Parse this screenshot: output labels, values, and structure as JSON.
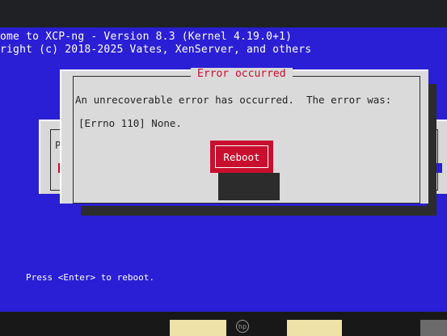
{
  "banner": {
    "line1": "ome to XCP-ng - Version 8.3 (Kernel 4.19.0+1)",
    "line2": "right (c) 2018-2025 Vates, XenServer, and others"
  },
  "background_dialog": {
    "label_prefix": "Pr"
  },
  "error_dialog": {
    "title": "Error occurred",
    "message_line1": "An unrecoverable error has occurred.  The error was:",
    "message_line2": "[Errno 110] None.",
    "reboot_label": "Reboot"
  },
  "footer": {
    "hint": "Press <Enter> to reboot."
  },
  "monitor": {
    "logo": "hp"
  },
  "colors": {
    "screen_blue": "#2a1fd4",
    "dialog_gray": "#dadada",
    "accent_red": "#c8102e"
  }
}
